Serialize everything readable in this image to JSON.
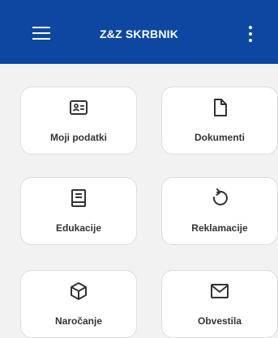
{
  "header": {
    "title": "Z&Z SKRBNIK",
    "background_color": "#0d47a1",
    "menu_icon": "hamburger-menu-icon",
    "more_icon": "more-vertical-icon"
  },
  "tiles": [
    {
      "label": "Moji podatki",
      "icon": "id-card-icon"
    },
    {
      "label": "Dokumenti",
      "icon": "document-icon"
    },
    {
      "label": "Edukacije",
      "icon": "book-icon"
    },
    {
      "label": "Reklamacije",
      "icon": "undo-arrow-icon"
    },
    {
      "label": "Naročanje",
      "icon": "box-icon"
    },
    {
      "label": "Obvestila",
      "icon": "envelope-icon"
    }
  ]
}
